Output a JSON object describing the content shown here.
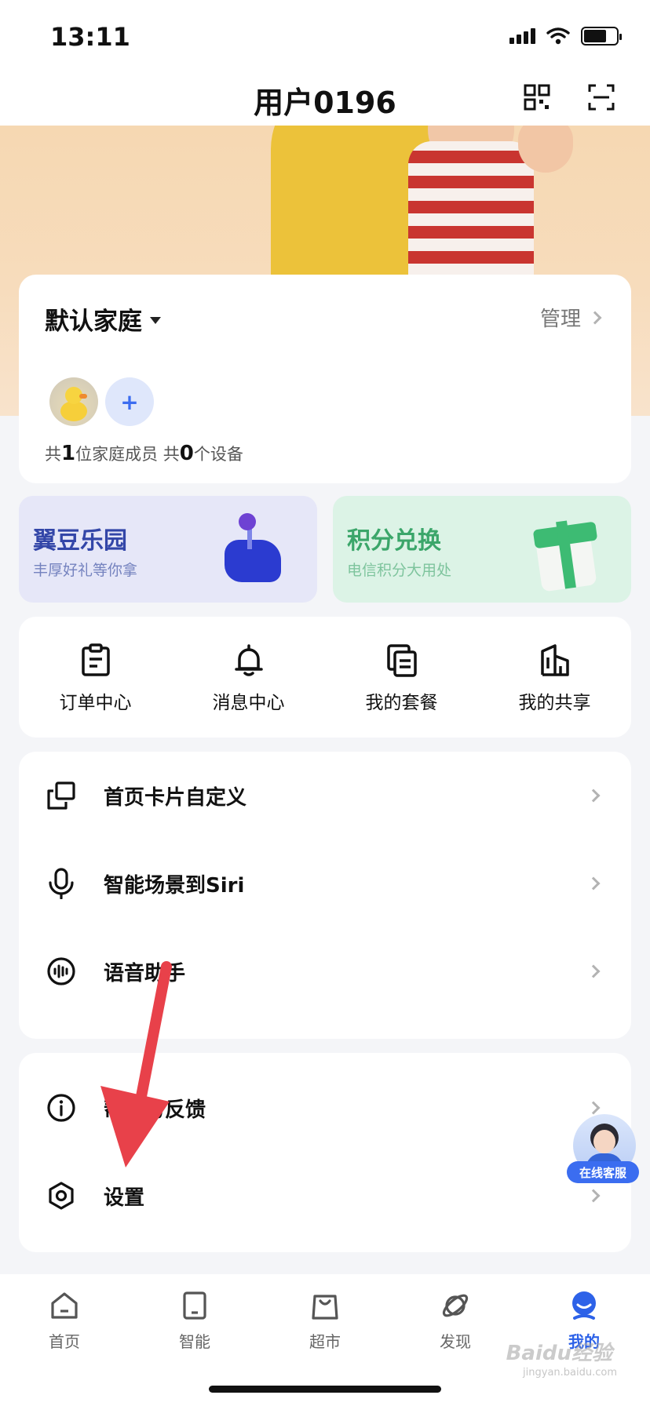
{
  "status_bar": {
    "time": "13:11"
  },
  "header": {
    "title": "用户0196",
    "qr_icon": "qr-code-icon",
    "scan_icon": "scan-icon"
  },
  "family": {
    "name": "默认家庭",
    "manage_label": "管理",
    "summary_prefix": "共",
    "member_count": "1",
    "member_suffix": "位家庭成员 共",
    "device_count": "0",
    "device_suffix": "个设备",
    "add_symbol": "+"
  },
  "promos": [
    {
      "title": "翼豆乐园",
      "subtitle": "丰厚好礼等你拿"
    },
    {
      "title": "积分兑换",
      "subtitle": "电信积分大用处"
    }
  ],
  "quick_actions": [
    {
      "label": "订单中心",
      "icon": "order-icon"
    },
    {
      "label": "消息中心",
      "icon": "bell-icon"
    },
    {
      "label": "我的套餐",
      "icon": "package-icon"
    },
    {
      "label": "我的共享",
      "icon": "share-building-icon"
    }
  ],
  "menu_group_1": [
    {
      "label": "首页卡片自定义",
      "icon": "card-customize-icon"
    },
    {
      "label": "智能场景到Siri",
      "icon": "microphone-icon"
    },
    {
      "label": "语音助手",
      "icon": "voice-wave-icon"
    }
  ],
  "menu_group_2": [
    {
      "label": "帮助与反馈",
      "icon": "info-icon"
    },
    {
      "label": "设置",
      "icon": "settings-hexagon-icon"
    }
  ],
  "customer_service": {
    "label": "在线客服"
  },
  "bottom_nav": [
    {
      "label": "首页",
      "icon": "home-icon",
      "active": false
    },
    {
      "label": "智能",
      "icon": "tablet-icon",
      "active": false
    },
    {
      "label": "超市",
      "icon": "shopping-bag-icon",
      "active": false
    },
    {
      "label": "发现",
      "icon": "planet-icon",
      "active": false
    },
    {
      "label": "我的",
      "icon": "profile-icon",
      "active": true
    }
  ],
  "watermark": {
    "text": "Baidu经验",
    "sub": "jingyan.baidu.com"
  },
  "colors": {
    "accent": "#2d62e8",
    "arrow": "#e8414a",
    "promo_a": "#3346a8",
    "promo_b": "#3ba66a"
  }
}
